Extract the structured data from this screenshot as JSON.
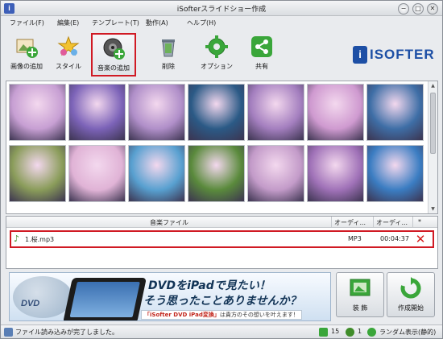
{
  "window": {
    "title": "iSofterスライドショー作成",
    "controls": {
      "minimize": "−",
      "maximize": "□",
      "close": "✕"
    }
  },
  "menu": [
    "ファイル(F)",
    "編集(E)",
    "テンプレート(T)",
    "動作(A)",
    "ヘルプ(H)"
  ],
  "toolbar": {
    "add_image": "画像の追加",
    "style": "スタイル",
    "add_music": "音楽の追加",
    "delete": "削除",
    "options": "オプション",
    "share": "共有"
  },
  "logo": {
    "mark": "i",
    "text": "ISOFTER"
  },
  "photos": {
    "count_visible": 14,
    "colors": [
      "#c79fd3",
      "#7c63b8",
      "#b08fc9",
      "#2b5a86",
      "#a47fbf",
      "#cf9ad0",
      "#3e6ea6",
      "#8a9c5a",
      "#e0b3d6",
      "#58a0d0",
      "#5a8a3c",
      "#c39bc9",
      "#a072b8",
      "#3b7dc2"
    ]
  },
  "music_list": {
    "columns": {
      "file": "音楽ファイル",
      "format": "オーディ...",
      "duration": "オーディ...",
      "extra": "*"
    },
    "rows": [
      {
        "name": "1.桜.mp3",
        "format": "MP3",
        "duration": "00:04:37"
      }
    ],
    "delete_icon": "✕"
  },
  "banner": {
    "dvd_label": "DVD",
    "line1": "DVDをiPadで見たい！",
    "line2": "そう思ったことありませんか？",
    "sub_product": "「iSofter DVD iPad変換」",
    "sub_rest": "は貴方のその想いを叶えます！"
  },
  "buttons": {
    "decorate": "装 飾",
    "create": "作成開始"
  },
  "status": {
    "message": "ファイル読み込みが完了しました。",
    "image_count": "15",
    "music_count": "1",
    "mode": "ランダム表示(静的)"
  },
  "colors": {
    "accent_red": "#d01a24",
    "brand_blue": "#1d4fa5",
    "toolbar_green": "#3aa63a"
  }
}
